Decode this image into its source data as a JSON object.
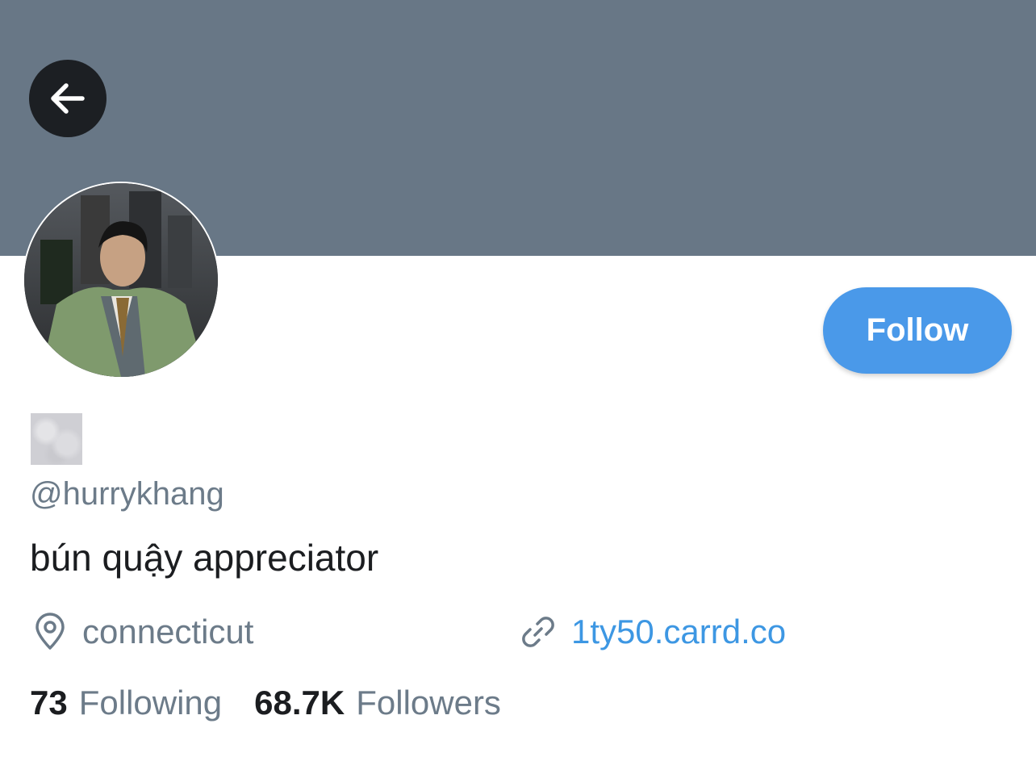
{
  "profile": {
    "handle": "@hurrykhang",
    "bio": "bún quậy appreciator",
    "location": "connecticut",
    "website": "1ty50.carrd.co",
    "following_count": "73",
    "following_label": "Following",
    "followers_count": "68.7K",
    "followers_label": "Followers"
  },
  "actions": {
    "follow_label": "Follow"
  },
  "icons": {
    "back": "arrow-left-icon",
    "location": "map-pin-icon",
    "website": "link-icon"
  },
  "colors": {
    "banner": "#687786",
    "follow_button": "#4a99e9",
    "link": "#3d97e3",
    "secondary_text": "#6c7b89"
  }
}
